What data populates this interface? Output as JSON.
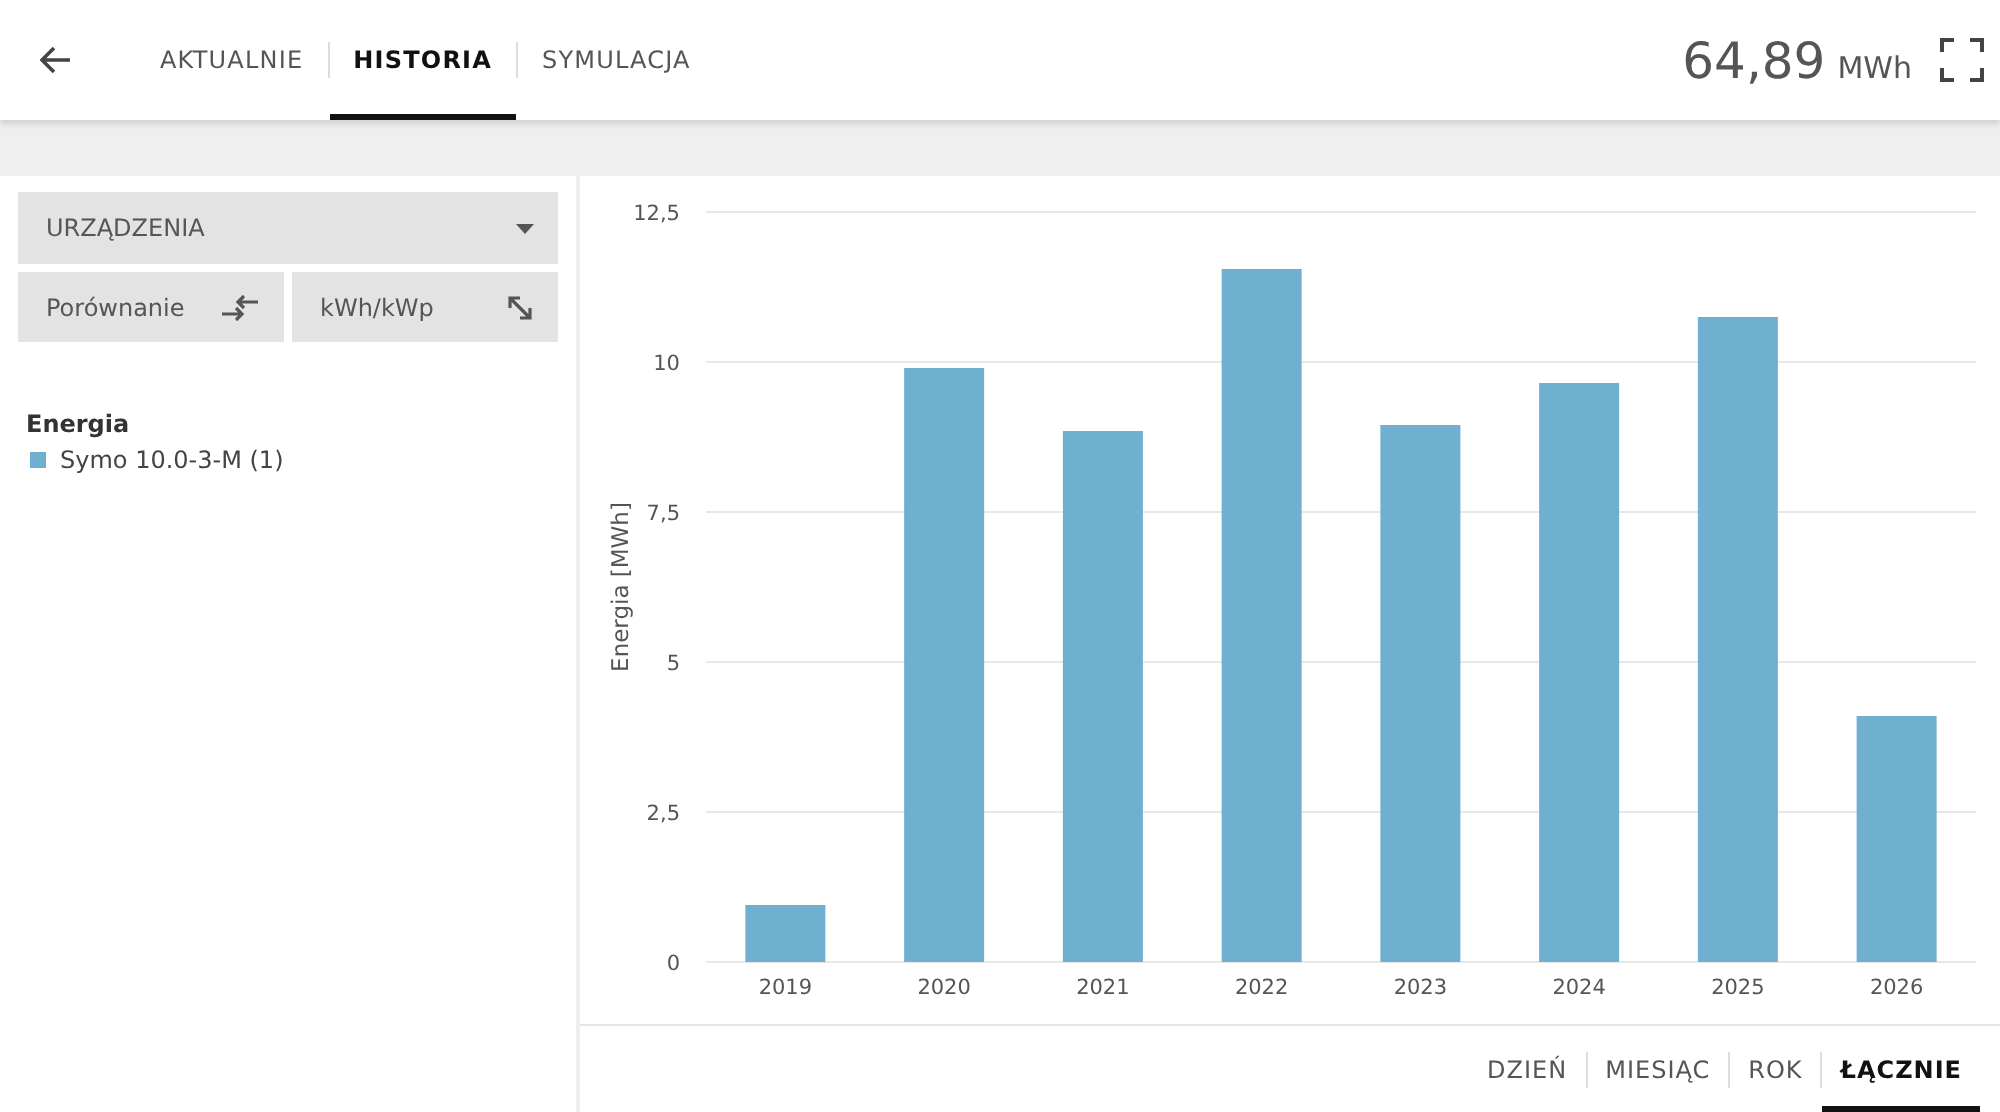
{
  "header": {
    "tabs": [
      {
        "label": "AKTUALNIE",
        "selected": false
      },
      {
        "label": "HISTORIA",
        "selected": true
      },
      {
        "label": "SYMULACJA",
        "selected": false
      }
    ],
    "total_value": "64,89",
    "total_unit": "MWh"
  },
  "sidebar": {
    "dropdown": "URZĄDZENIA",
    "buttons": [
      {
        "label": "Porównanie",
        "kind": "compare"
      },
      {
        "label": "kWh/kWp",
        "kind": "scale"
      }
    ],
    "legend_title": "Energia"
  },
  "chart": {
    "chart_data": {
      "type": "bar",
      "ylabel": "Energia [MWh]",
      "categories": [
        "2019",
        "2020",
        "2021",
        "2022",
        "2023",
        "2024",
        "2025",
        "2026"
      ],
      "series": [
        {
          "name": "Symo 10.0-3-M (1)",
          "color": "#6fafd0",
          "values": [
            0.95,
            9.9,
            8.85,
            11.55,
            8.95,
            9.65,
            10.75,
            4.1
          ]
        }
      ],
      "ylim": [
        0,
        12.5
      ],
      "grid": true,
      "yticks": [
        {
          "value": 0,
          "label": "0"
        },
        {
          "value": 2.5,
          "label": "2,5"
        },
        {
          "value": 5,
          "label": "5"
        },
        {
          "value": 7.5,
          "label": "7,5"
        },
        {
          "value": 10,
          "label": "10"
        },
        {
          "value": 12.5,
          "label": "12,5"
        }
      ]
    }
  },
  "period_tabs": [
    {
      "label": "DZIEŃ",
      "selected": false
    },
    {
      "label": "MIESIĄC",
      "selected": false
    },
    {
      "label": "ROK",
      "selected": false
    },
    {
      "label": "ŁĄCZNIE",
      "selected": true
    }
  ]
}
